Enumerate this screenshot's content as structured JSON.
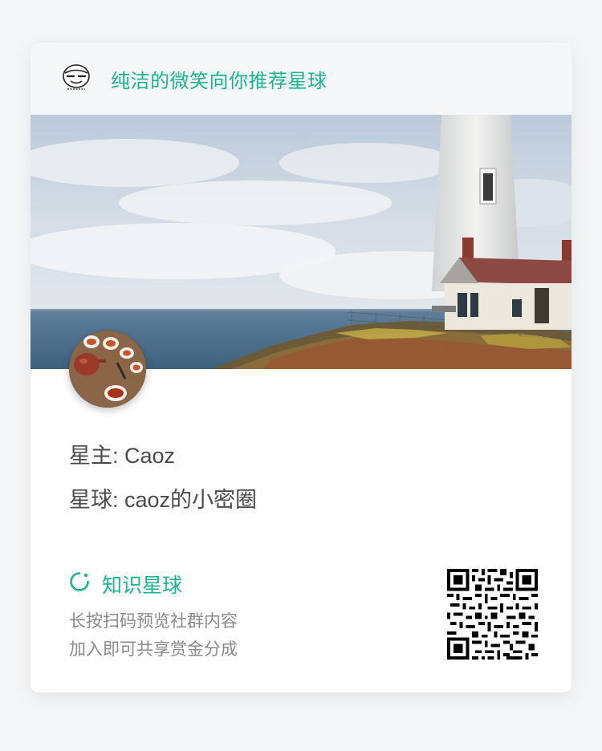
{
  "header": {
    "title": "纯洁的微笑向你推荐星球",
    "logo_icon": "cartoon-face-logo-icon"
  },
  "banner": {
    "image": "lighthouse-by-the-sea-photo"
  },
  "avatar": {
    "image": "tea-set-avatar"
  },
  "info": {
    "owner": "星主: Caoz",
    "planet": "星球: caoz的小密圈"
  },
  "brand": {
    "icon": "refresh-circle-icon",
    "label": "知识星球"
  },
  "description": {
    "line1": "长按扫码预览社群内容",
    "line2": "加入即可共享赏金分成"
  },
  "qr_code": "qr-code",
  "colors": {
    "accent": "#19b491",
    "background": "#f4f6f8",
    "card": "#ffffff",
    "text_primary": "#4a4a4a",
    "text_secondary": "#8a8a8a"
  }
}
